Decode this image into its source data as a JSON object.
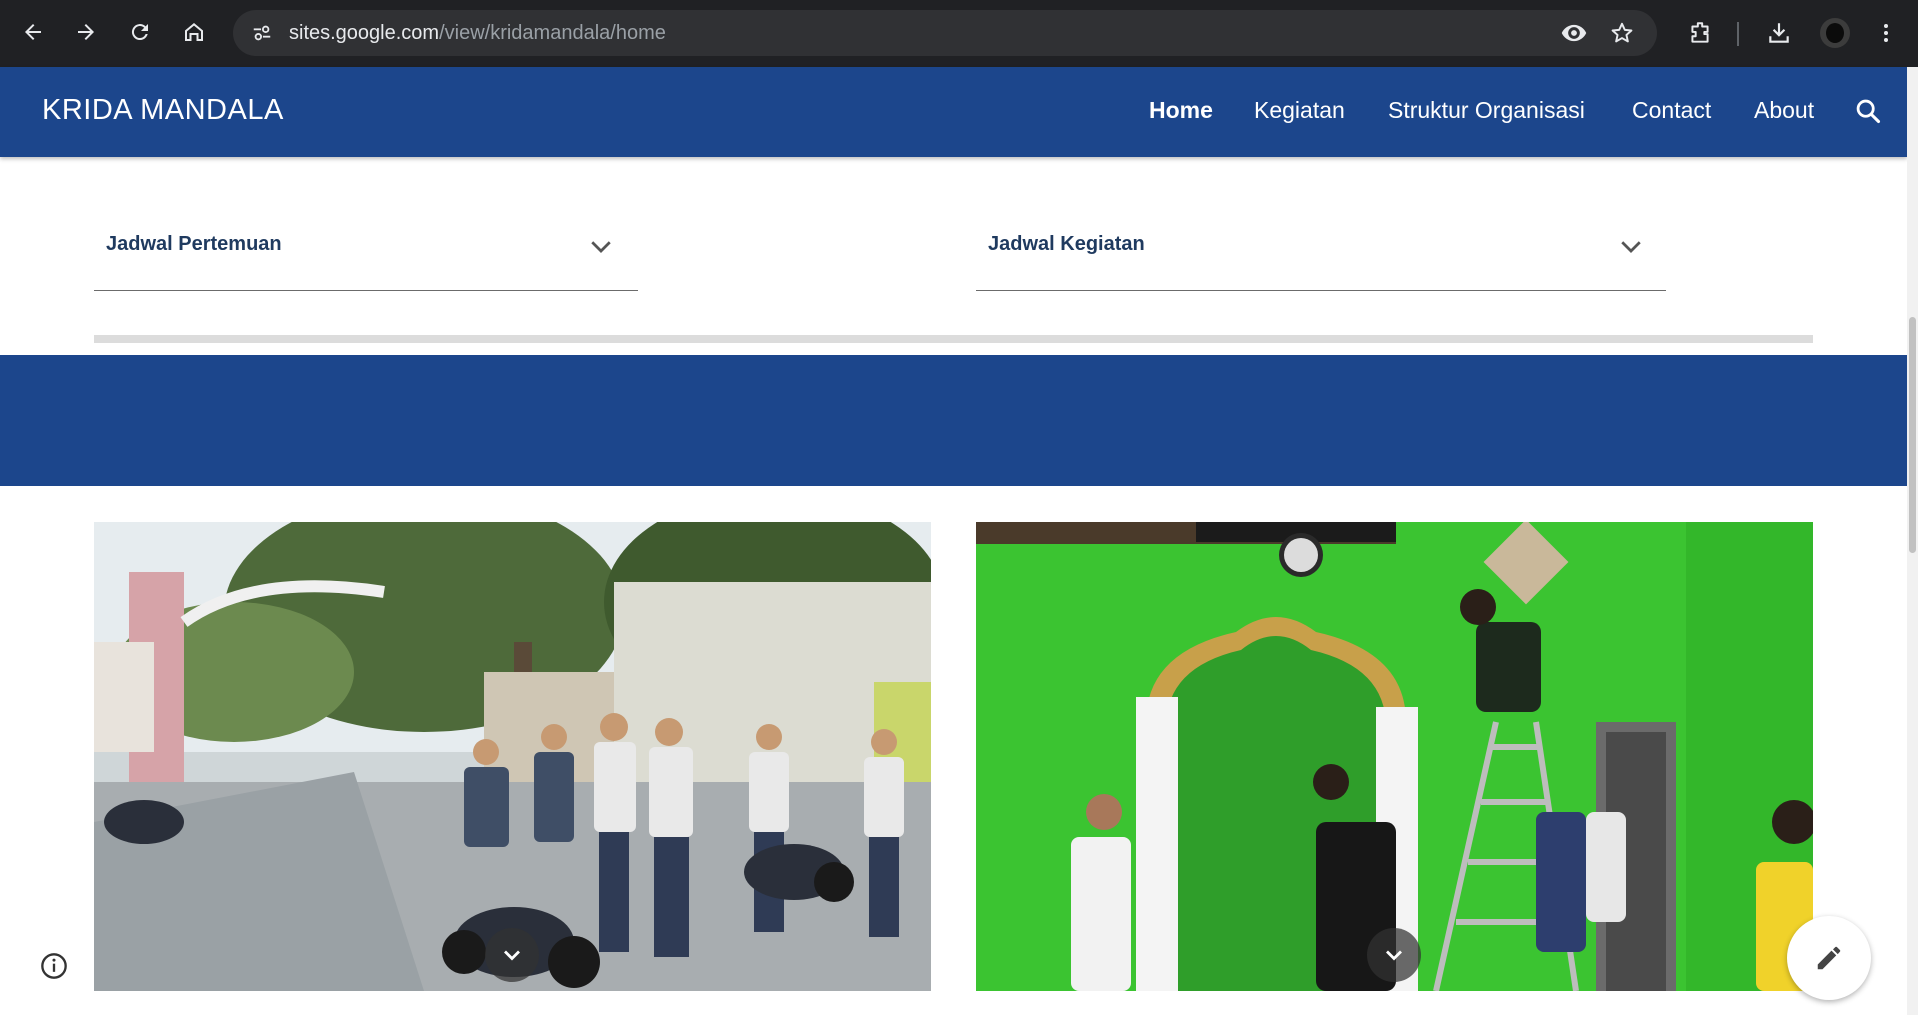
{
  "browser": {
    "url_host": "sites.google.com",
    "url_path": "/view/kridamandala/home",
    "icons": [
      "back-icon",
      "forward-icon",
      "reload-icon",
      "home-icon",
      "site-info-icon",
      "eye-icon",
      "star-icon",
      "extensions-icon",
      "download-icon",
      "profile-avatar",
      "menu-dots-icon"
    ]
  },
  "site": {
    "title": "KRIDA MANDALA",
    "nav": [
      {
        "label": "Home",
        "active": true
      },
      {
        "label": "Kegiatan",
        "active": false
      },
      {
        "label": "Struktur Organisasi",
        "active": false
      },
      {
        "label": "Contact",
        "active": false
      },
      {
        "label": "About",
        "active": false
      }
    ],
    "search_icon": "search-icon"
  },
  "sections": {
    "collapsibles": [
      {
        "label": "Jadwal Pertemuan",
        "icon": "chevron-down-icon"
      },
      {
        "label": "Jadwal Kegiatan",
        "icon": "chevron-down-icon"
      }
    ]
  },
  "photos": [
    {
      "name": "street-gathering-photo",
      "icon": "chevron-down-icon"
    },
    {
      "name": "mosque-cleaning-photo",
      "icon": "chevron-down-icon"
    }
  ],
  "colors": {
    "header_bg": "#1c468c",
    "chrome_bg": "#202124",
    "collapsible_text": "#1f3a5f",
    "mosque_wall": "#3bc431"
  },
  "floating": {
    "info_icon": "info-icon",
    "edit_icon": "pencil-icon"
  }
}
